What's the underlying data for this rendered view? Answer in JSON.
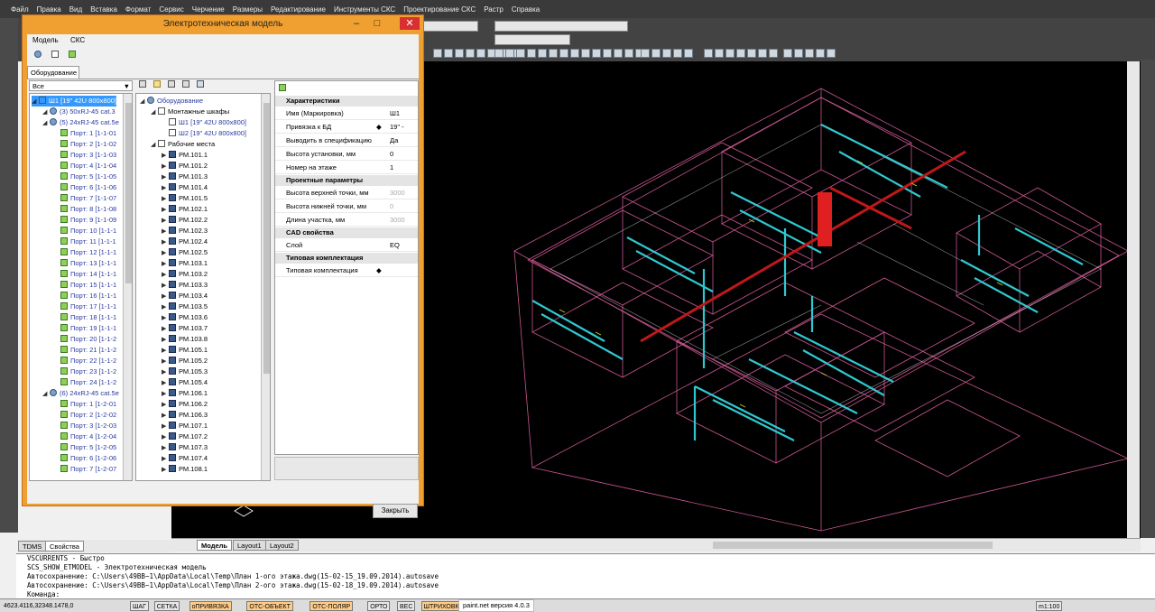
{
  "menubar": [
    "Файл",
    "Правка",
    "Вид",
    "Вставка",
    "Формат",
    "Сервис",
    "Черчение",
    "Размеры",
    "Редактирование",
    "Инструменты СКС",
    "Проектирование СКС",
    "Растр",
    "Справка"
  ],
  "window": {
    "title": "Электротехническая модель"
  },
  "dialog_menu": [
    "Модель",
    "СКС"
  ],
  "tab": "Оборудование",
  "filter": {
    "value": "Все"
  },
  "left_tree": [
    {
      "label": "Ш1 [19\" 42U 800x800]",
      "kind": "cabinet",
      "indent": 0,
      "selected": true
    },
    {
      "label": "(3) 50xRJ-45 cat.3",
      "kind": "net",
      "indent": 1
    },
    {
      "label": "(5) 24xRJ-45 cat.5e",
      "kind": "net",
      "indent": 1
    },
    {
      "label": "Порт: 1 [1-1-01",
      "kind": "port",
      "indent": 2
    },
    {
      "label": "Порт: 2 [1-1-02",
      "kind": "port",
      "indent": 2
    },
    {
      "label": "Порт: 3 [1-1-03",
      "kind": "port",
      "indent": 2
    },
    {
      "label": "Порт: 4 [1-1-04",
      "kind": "port",
      "indent": 2
    },
    {
      "label": "Порт: 5 [1-1-05",
      "kind": "port",
      "indent": 2
    },
    {
      "label": "Порт: 6 [1-1-06",
      "kind": "port",
      "indent": 2
    },
    {
      "label": "Порт: 7 [1-1-07",
      "kind": "port",
      "indent": 2
    },
    {
      "label": "Порт: 8 [1-1-08",
      "kind": "port",
      "indent": 2
    },
    {
      "label": "Порт: 9 [1-1-09",
      "kind": "port",
      "indent": 2
    },
    {
      "label": "Порт: 10 [1-1-1",
      "kind": "port",
      "indent": 2
    },
    {
      "label": "Порт: 11 [1-1-1",
      "kind": "port",
      "indent": 2
    },
    {
      "label": "Порт: 12 [1-1-1",
      "kind": "port",
      "indent": 2
    },
    {
      "label": "Порт: 13 [1-1-1",
      "kind": "port",
      "indent": 2
    },
    {
      "label": "Порт: 14 [1-1-1",
      "kind": "port",
      "indent": 2
    },
    {
      "label": "Порт: 15 [1-1-1",
      "kind": "port",
      "indent": 2
    },
    {
      "label": "Порт: 16 [1-1-1",
      "kind": "port",
      "indent": 2
    },
    {
      "label": "Порт: 17 [1-1-1",
      "kind": "port",
      "indent": 2
    },
    {
      "label": "Порт: 18 [1-1-1",
      "kind": "port",
      "indent": 2
    },
    {
      "label": "Порт: 19 [1-1-1",
      "kind": "port",
      "indent": 2
    },
    {
      "label": "Порт: 20 [1-1-2",
      "kind": "port",
      "indent": 2
    },
    {
      "label": "Порт: 21 [1-1-2",
      "kind": "port",
      "indent": 2
    },
    {
      "label": "Порт: 22 [1-1-2",
      "kind": "port",
      "indent": 2
    },
    {
      "label": "Порт: 23 [1-1-2",
      "kind": "port",
      "indent": 2
    },
    {
      "label": "Порт: 24 [1-1-2",
      "kind": "port",
      "indent": 2
    },
    {
      "label": "(6) 24xRJ-45 cat.5e",
      "kind": "net",
      "indent": 1
    },
    {
      "label": "Порт: 1 [1-2-01",
      "kind": "port",
      "indent": 2
    },
    {
      "label": "Порт: 2 [1-2-02",
      "kind": "port",
      "indent": 2
    },
    {
      "label": "Порт: 3 [1-2-03",
      "kind": "port",
      "indent": 2
    },
    {
      "label": "Порт: 4 [1-2-04",
      "kind": "port",
      "indent": 2
    },
    {
      "label": "Порт: 5 [1-2-05",
      "kind": "port",
      "indent": 2
    },
    {
      "label": "Порт: 6 [1-2-06",
      "kind": "port",
      "indent": 2
    },
    {
      "label": "Порт: 7 [1-2-07",
      "kind": "port",
      "indent": 2
    }
  ],
  "mid_tree": [
    {
      "label": "Оборудование",
      "kind": "net",
      "indent": 0
    },
    {
      "label": "Монтажные шкафы",
      "kind": "folder",
      "indent": 1
    },
    {
      "label": "Ш1 [19\" 42U 800x800]",
      "kind": "cabinet",
      "indent": 2
    },
    {
      "label": "Ш2 [19\" 42U 800x800]",
      "kind": "cabinet",
      "indent": 2
    },
    {
      "label": "Рабочие места",
      "kind": "folder",
      "indent": 1
    },
    {
      "label": "РМ.101.1",
      "kind": "pc",
      "indent": 2
    },
    {
      "label": "РМ.101.2",
      "kind": "pc",
      "indent": 2
    },
    {
      "label": "РМ.101.3",
      "kind": "pc",
      "indent": 2
    },
    {
      "label": "РМ.101.4",
      "kind": "pc",
      "indent": 2
    },
    {
      "label": "РМ.101.5",
      "kind": "pc",
      "indent": 2
    },
    {
      "label": "РМ.102.1",
      "kind": "pc",
      "indent": 2
    },
    {
      "label": "РМ.102.2",
      "kind": "pc",
      "indent": 2
    },
    {
      "label": "РМ.102.3",
      "kind": "pc",
      "indent": 2
    },
    {
      "label": "РМ.102.4",
      "kind": "pc",
      "indent": 2
    },
    {
      "label": "РМ.102.5",
      "kind": "pc",
      "indent": 2
    },
    {
      "label": "РМ.103.1",
      "kind": "pc",
      "indent": 2
    },
    {
      "label": "РМ.103.2",
      "kind": "pc",
      "indent": 2
    },
    {
      "label": "РМ.103.3",
      "kind": "pc",
      "indent": 2
    },
    {
      "label": "РМ.103.4",
      "kind": "pc",
      "indent": 2
    },
    {
      "label": "РМ.103.5",
      "kind": "pc",
      "indent": 2
    },
    {
      "label": "РМ.103.6",
      "kind": "pc",
      "indent": 2
    },
    {
      "label": "РМ.103.7",
      "kind": "pc",
      "indent": 2
    },
    {
      "label": "РМ.103.8",
      "kind": "pc",
      "indent": 2
    },
    {
      "label": "РМ.105.1",
      "kind": "pc",
      "indent": 2
    },
    {
      "label": "РМ.105.2",
      "kind": "pc",
      "indent": 2
    },
    {
      "label": "РМ.105.3",
      "kind": "pc",
      "indent": 2
    },
    {
      "label": "РМ.105.4",
      "kind": "pc",
      "indent": 2
    },
    {
      "label": "РМ.106.1",
      "kind": "pc",
      "indent": 2
    },
    {
      "label": "РМ.106.2",
      "kind": "pc",
      "indent": 2
    },
    {
      "label": "РМ.106.3",
      "kind": "pc",
      "indent": 2
    },
    {
      "label": "РМ.107.1",
      "kind": "pc",
      "indent": 2
    },
    {
      "label": "РМ.107.2",
      "kind": "pc",
      "indent": 2
    },
    {
      "label": "РМ.107.3",
      "kind": "pc",
      "indent": 2
    },
    {
      "label": "РМ.107.4",
      "kind": "pc",
      "indent": 2
    },
    {
      "label": "РМ.108.1",
      "kind": "pc",
      "indent": 2
    }
  ],
  "properties": [
    {
      "type": "header",
      "label": "Характеристики"
    },
    {
      "type": "row",
      "key": "Имя (Маркировка)",
      "value": "Ш1"
    },
    {
      "type": "row",
      "key": "Привязка к БД",
      "value": "19\" -",
      "mark": "◆"
    },
    {
      "type": "row",
      "key": "Выводить в спецификацию",
      "value": "Да"
    },
    {
      "type": "row",
      "key": "Высота установки, мм",
      "value": "0"
    },
    {
      "type": "row",
      "key": "Номер на этаже",
      "value": "1"
    },
    {
      "type": "header",
      "label": "Проектные параметры"
    },
    {
      "type": "row",
      "key": "Высота верхней точки, мм",
      "value": "3000",
      "dim": true
    },
    {
      "type": "row",
      "key": "Высота нижней точки, мм",
      "value": "0",
      "dim": true
    },
    {
      "type": "row",
      "key": "Длина участка, мм",
      "value": "3000",
      "dim": true
    },
    {
      "type": "header",
      "label": "CAD свойства"
    },
    {
      "type": "row",
      "key": "Слой",
      "value": "EQ"
    },
    {
      "type": "header",
      "label": "Типовая комплектация"
    },
    {
      "type": "row",
      "key": "Типовая комплектация",
      "value": "",
      "mark": "◆"
    }
  ],
  "close_label": "Закрыть",
  "layout_tabs": [
    "Модель",
    "Layout1",
    "Layout2"
  ],
  "side_tabs": [
    "TDMS",
    "Свойства"
  ],
  "command_lines": [
    "VSCURRENTS - Быстро",
    "SCS_SHOW_ETMODEL - Электротехническая модель",
    "Автосохранение: C:\\Users\\49BB~1\\AppData\\Local\\Temp\\План 1-ого этажа.dwg(15-02-15_19.09.2014).autosave",
    "Автосохранение: C:\\Users\\49BB~1\\AppData\\Local\\Temp\\План 2-ого этажа.dwg(15-02-18_19.09.2014).autosave",
    "Команда:"
  ],
  "coords": "4623.4116,32348.1478,0",
  "status_buttons": [
    {
      "label": "ШАГ",
      "on": false
    },
    {
      "label": "СЕТКА",
      "on": false
    },
    {
      "label": "оПРИВЯЗКА",
      "on": true
    },
    {
      "label": "ОТС-ОБЪЕКТ",
      "on": true
    },
    {
      "label": "ОТС-ПОЛЯР",
      "on": true
    },
    {
      "label": "ОРТО",
      "on": false
    },
    {
      "label": "ВЕС",
      "on": false
    },
    {
      "label": "ШТРИХОВКА",
      "on": true
    }
  ],
  "paintnet": "paint.net версия 4.0.3",
  "scale": "m1:100",
  "colors": {
    "canvas": "#000000",
    "wall": "#e060a0",
    "tray": "#30c8d0",
    "trunk": "#c01818",
    "dialog_frame": "#f0a030"
  }
}
